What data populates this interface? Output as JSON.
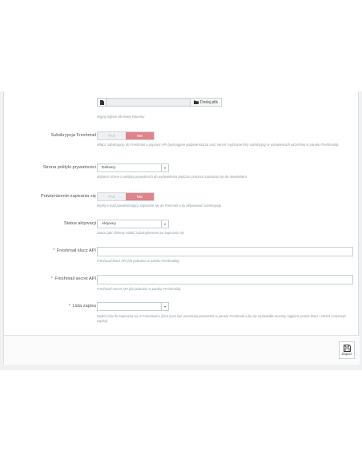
{
  "image_upload": {
    "button_label": "Dodaj plik",
    "help": "Wgraj zdjęcie dla lewej kolumny"
  },
  "subscription": {
    "label": "Subskrypcja Freshmail",
    "off_label": "TAK",
    "on_label": "NIE",
    "help": "Włącz subskrypcję do Freshmail a poprzez API (wymagane podanie klucza oraz secret i wybranie listy subskrypcji w ustawieniach wcześniej w panelu Freshmaila)"
  },
  "privacy_page": {
    "label": "Strona polityki prywatności",
    "value": "Delivery",
    "help": "Wybierz stronę z polityką prywatności do wyświetlenia podczas procesu zapisania się do newslettera"
  },
  "confirmation": {
    "label": "Potwierdzenie zapisania się",
    "off_label": "TAK",
    "on_label": "NIE",
    "help": "Wyślij e-mail potwierdzający zapisanie się do Frehmail-a by aktywować subskrypcję"
  },
  "activation_status": {
    "label": "Status aktywacji",
    "value": "Aktywny",
    "help": "Status jaki chcemy nadać subskrybentowi po zapisaniu się"
  },
  "api_key": {
    "required_mark": "*",
    "label": "Freshmail klucz API",
    "value": "",
    "help": "Freshmail klucz API (do pobrania w panelu Freshmaila)"
  },
  "api_secret": {
    "required_mark": "*",
    "label": "Freshmail secret API",
    "value": "",
    "help": "Freshmail secret API (do pobrania w panelu Freshmaila)"
  },
  "list": {
    "required_mark": "*",
    "label": "Lista zapisu",
    "value": "",
    "help": "Wybór listy do zapisania się w Freshmail u (lista musi być wcześniej utworzona w panelu Freshmail-a by się wyświetliła musimy najpierw podać klucz i secret i nacisnąć zapisz)"
  },
  "footer": {
    "save_label": "Zapisz"
  },
  "colors": {
    "toggle_active": "#e1838b",
    "required": "#e0434d",
    "help_text": "#8a9aa3"
  },
  "icons": [
    "image-icon",
    "folder-icon",
    "chevron-down-icon",
    "save-icon"
  ]
}
